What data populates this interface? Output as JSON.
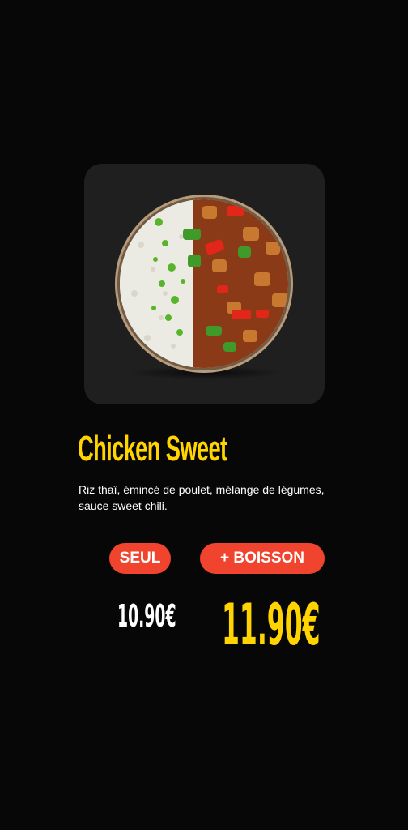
{
  "product": {
    "name": "Chicken Sweet",
    "description": "Riz thaï, émincé de poulet, mélange de légumes, sauce sweet chili.",
    "image_alt": "bowl of thai rice with chicken and vegetables"
  },
  "options": [
    {
      "label": "SEUL",
      "price": "10.90€"
    },
    {
      "label": "+ BOISSON",
      "price": "11.90€"
    }
  ],
  "colors": {
    "background": "#070707",
    "card": "#1f1f1f",
    "accent_yellow": "#ffd400",
    "pill_red": "#f0442e"
  }
}
